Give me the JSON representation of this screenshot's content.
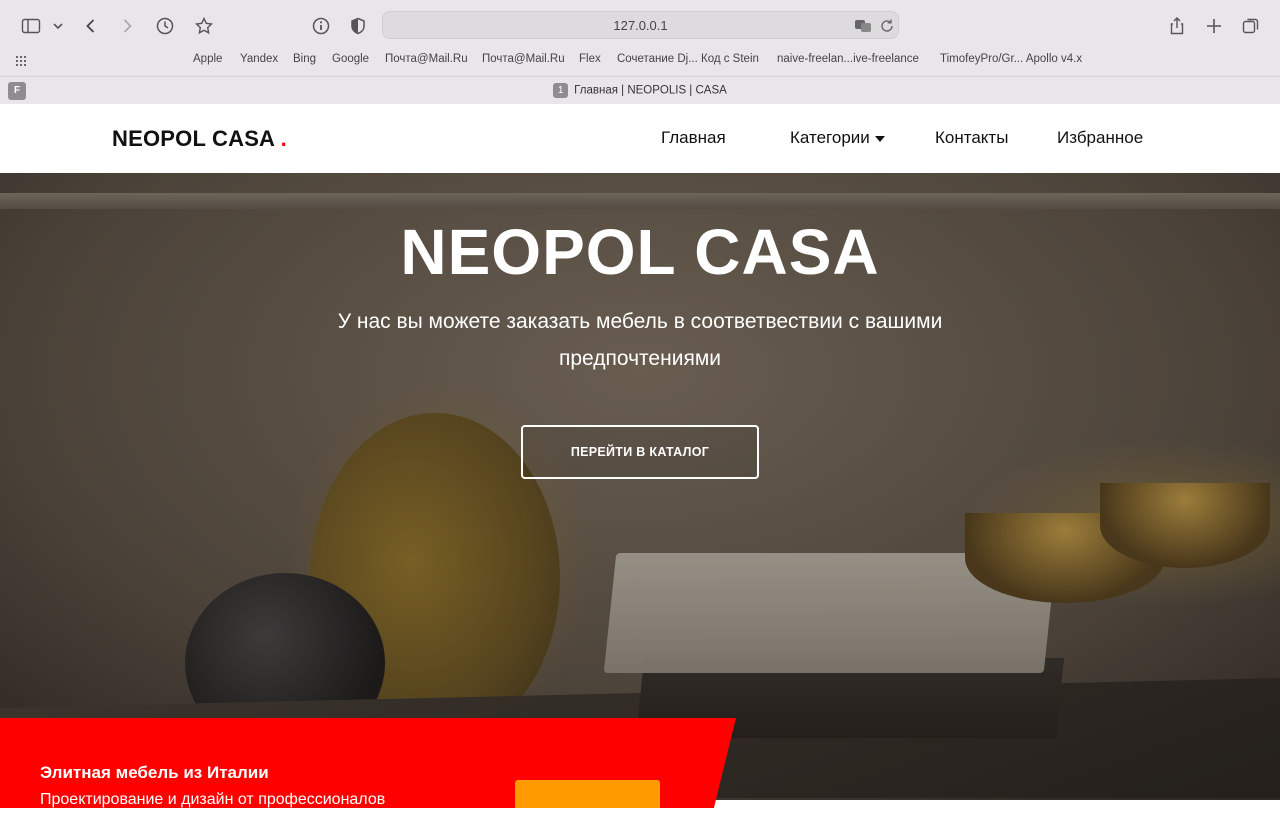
{
  "browser": {
    "address": "127.0.0.1",
    "bookmarks": [
      "Apple",
      "Yandex",
      "Bing",
      "Google",
      "Почта@Mail.Ru",
      "Почта@Mail.Ru",
      "Flex",
      "Сочетание Dj... Код с Stein",
      "naive-freelan...ive-freelance",
      "TimofeyPro/Gr... Apollo v4.x"
    ],
    "tab_favicon_letter": "F",
    "tab_number": "1",
    "tab_title": "Главная | NEOPOLIS | CASA"
  },
  "header": {
    "logo": "NEOPOL CASA",
    "logo_dot": ".",
    "logo_dot_color": "#ff0000",
    "nav": {
      "home": "Главная",
      "categories": "Категории",
      "contacts": "Контакты",
      "favorites": "Избранное"
    }
  },
  "hero": {
    "title": "NEOPOL CASA",
    "subtitle": "У нас вы можете заказать мебель в соответвествии с вашими предпочтениями",
    "cta": "ПЕРЕЙТИ В КАТАЛОГ"
  },
  "promo": {
    "title": "Элитная мебель из Италии",
    "text": "Проектирование и дизайн от профессионалов",
    "background_color": "#ff0000",
    "button_color": "#ff9a00"
  }
}
